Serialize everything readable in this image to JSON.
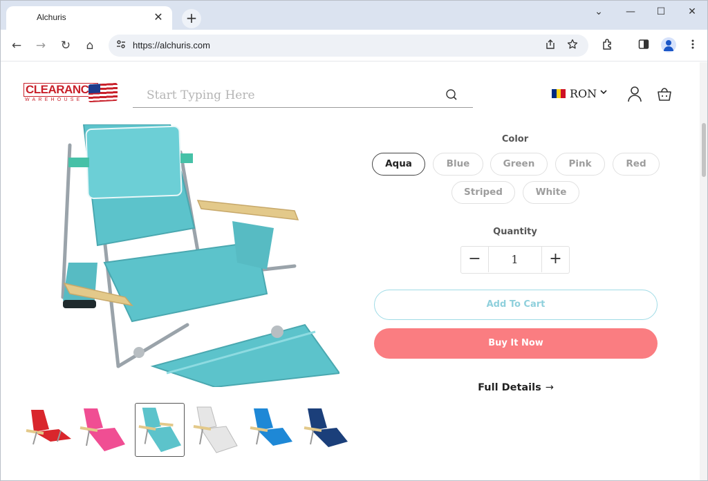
{
  "browser": {
    "tab_title": "Alchuris",
    "tab_close": "✕",
    "new_tab": "+",
    "url": "https://alchuris.com",
    "window_controls": {
      "collapse": "⌄",
      "minimize": "—",
      "maximize": "☐",
      "close": "✕"
    },
    "nav": {
      "back": "←",
      "forward": "→",
      "reload": "↻",
      "home": "⌂"
    }
  },
  "header": {
    "logo_text": "CLEARANCE",
    "logo_sub": "WAREHOUSE",
    "search_placeholder": "Start Typing Here",
    "currency": "RON"
  },
  "product": {
    "color_label": "Color",
    "colors": [
      "Aqua",
      "Blue",
      "Green",
      "Pink",
      "Red",
      "Striped",
      "White"
    ],
    "selected_color": "Aqua",
    "quantity_label": "Quantity",
    "quantity": "1",
    "qty_minus": "−",
    "qty_plus": "+",
    "add_to_cart": "Add To Cart",
    "buy_now": "Buy It Now",
    "full_details": "Full Details",
    "full_details_arrow": "→",
    "thumbnails": [
      "red",
      "pink",
      "aqua",
      "white",
      "blue",
      "navy"
    ],
    "selected_thumbnail": 2
  },
  "colors": {
    "accent_buy": "#fa7d81",
    "accent_cart": "#8fd0dc",
    "chair_aqua": "#5cc3cb",
    "brand_red": "#c8202a"
  }
}
